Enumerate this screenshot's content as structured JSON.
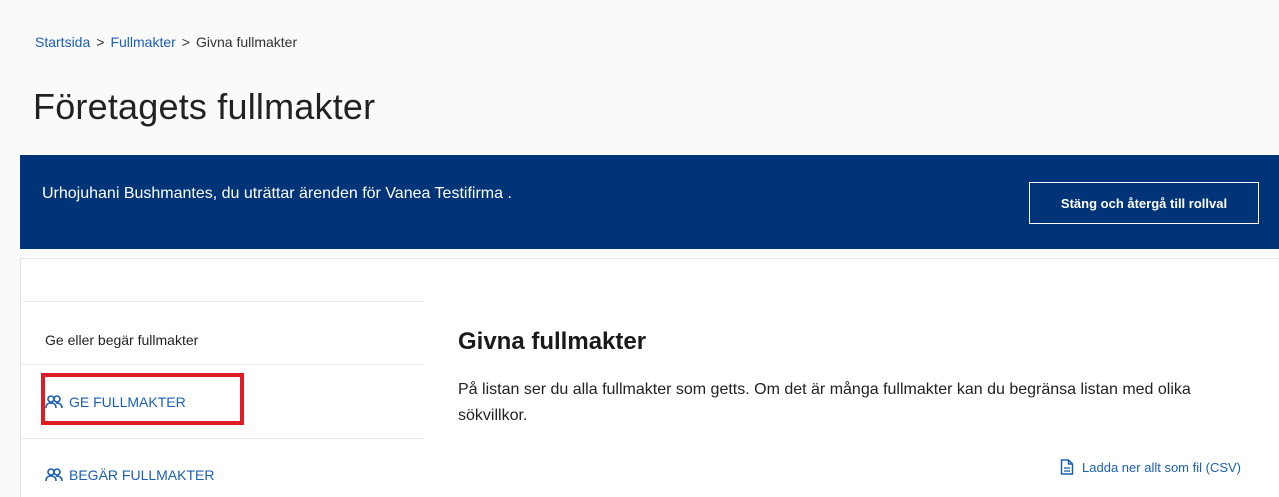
{
  "breadcrumb": {
    "items": [
      {
        "label": "Startsida",
        "link": true
      },
      {
        "label": "Fullmakter",
        "link": true
      },
      {
        "label": "Givna fullmakter",
        "link": false
      }
    ],
    "separator": ">"
  },
  "page": {
    "title": "Företagets fullmakter"
  },
  "role_banner": {
    "text": "Urhojuhani Bushmantes, du uträttar ärenden för Vanea Testifirma .",
    "button_label": "Stäng och återgå till rollval"
  },
  "sidebar": {
    "heading": "Ge eller begär fullmakter",
    "items": [
      {
        "label": "GE FULLMAKTER",
        "icon": "users-icon",
        "highlighted": true
      },
      {
        "label": "BEGÄR FULLMAKTER",
        "icon": "users-icon",
        "highlighted": false
      }
    ]
  },
  "main": {
    "title": "Givna fullmakter",
    "description": "På listan ser du alla fullmakter som getts. Om det är många fullmakter kan du begränsa listan med olika sökvillkor.",
    "download_label": "Ladda ner allt som fil (CSV)",
    "download_icon": "document-icon"
  },
  "colors": {
    "banner": "#003478",
    "link": "#1a5fb4",
    "highlight": "#e01b24"
  }
}
